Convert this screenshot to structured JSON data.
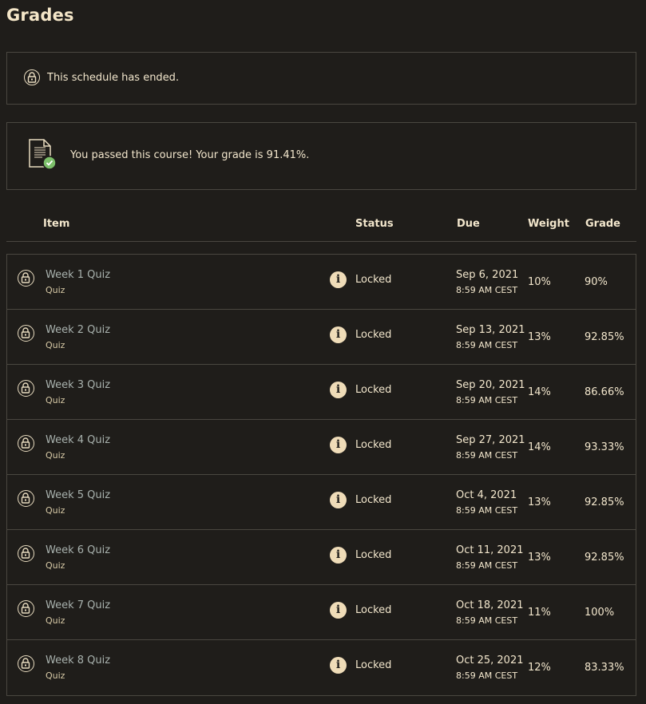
{
  "page": {
    "title": "Grades"
  },
  "notices": {
    "ended": {
      "text": "This schedule has ended.",
      "icon": "lock-icon"
    },
    "passed": {
      "text": "You passed this course! Your grade is 91.41%.",
      "icon": "document-check-icon"
    }
  },
  "table": {
    "headers": {
      "item": "Item",
      "status": "Status",
      "due": "Due",
      "weight": "Weight",
      "grade": "Grade"
    },
    "rows": [
      {
        "title": "Week 1 Quiz",
        "type": "Quiz",
        "status": "Locked",
        "due_date": "Sep 6, 2021",
        "due_time": "8:59 AM CEST",
        "weight": "10%",
        "grade": "90%"
      },
      {
        "title": "Week 2 Quiz",
        "type": "Quiz",
        "status": "Locked",
        "due_date": "Sep 13, 2021",
        "due_time": "8:59 AM CEST",
        "weight": "13%",
        "grade": "92.85%"
      },
      {
        "title": "Week 3 Quiz",
        "type": "Quiz",
        "status": "Locked",
        "due_date": "Sep 20, 2021",
        "due_time": "8:59 AM CEST",
        "weight": "14%",
        "grade": "86.66%"
      },
      {
        "title": "Week 4 Quiz",
        "type": "Quiz",
        "status": "Locked",
        "due_date": "Sep 27, 2021",
        "due_time": "8:59 AM CEST",
        "weight": "14%",
        "grade": "93.33%"
      },
      {
        "title": "Week 5 Quiz",
        "type": "Quiz",
        "status": "Locked",
        "due_date": "Oct 4, 2021",
        "due_time": "8:59 AM CEST",
        "weight": "13%",
        "grade": "92.85%"
      },
      {
        "title": "Week 6 Quiz",
        "type": "Quiz",
        "status": "Locked",
        "due_date": "Oct 11, 2021",
        "due_time": "8:59 AM CEST",
        "weight": "13%",
        "grade": "92.85%"
      },
      {
        "title": "Week 7 Quiz",
        "type": "Quiz",
        "status": "Locked",
        "due_date": "Oct 18, 2021",
        "due_time": "8:59 AM CEST",
        "weight": "11%",
        "grade": "100%"
      },
      {
        "title": "Week 8 Quiz",
        "type": "Quiz",
        "status": "Locked",
        "due_date": "Oct 25, 2021",
        "due_time": "8:59 AM CEST",
        "weight": "12%",
        "grade": "83.33%"
      }
    ]
  },
  "icons": {
    "row_lock": "lock-icon",
    "status_info": "info-icon"
  },
  "colors": {
    "background": "#1f1d1a",
    "border": "#4a4740",
    "text": "#f2e6cc",
    "item_link": "#a9b2ae",
    "info_badge": "#efdcb8",
    "success": "#7cbf6a"
  }
}
